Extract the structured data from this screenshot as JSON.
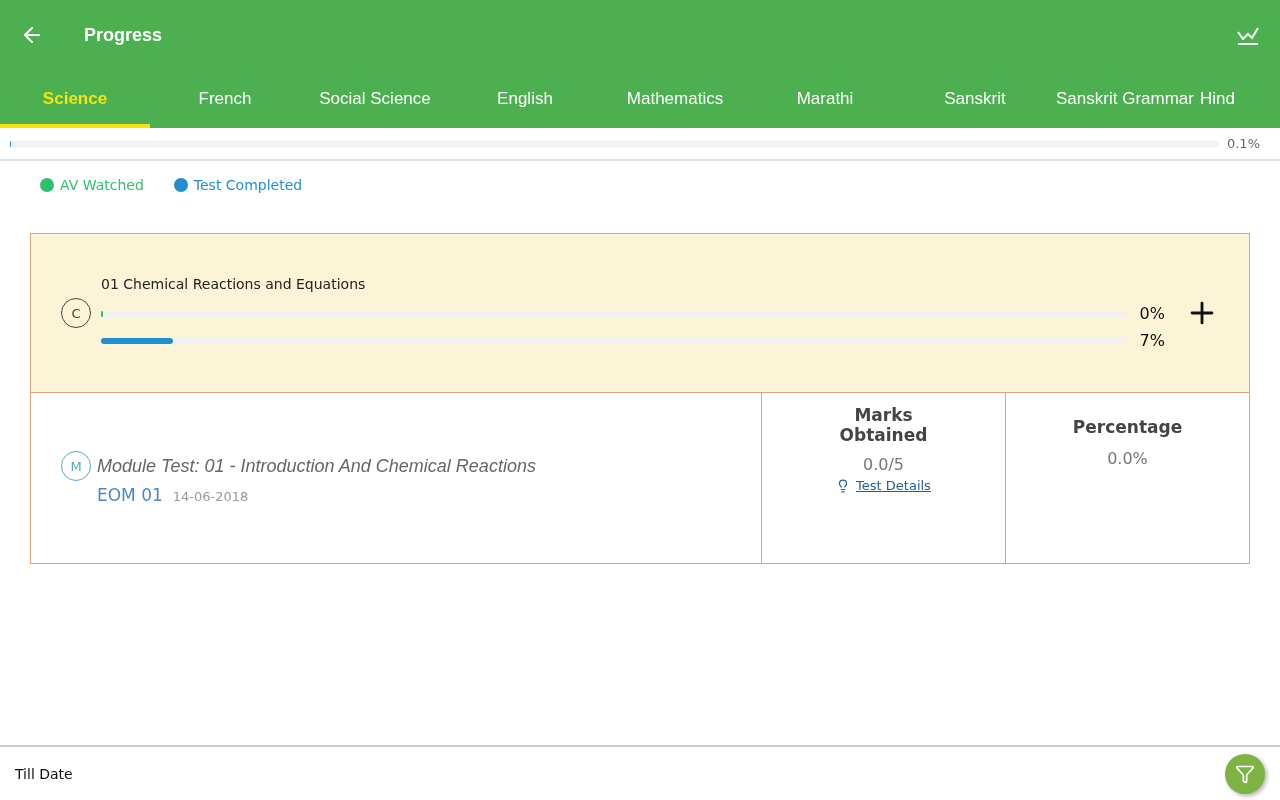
{
  "header": {
    "title": "Progress"
  },
  "tabs": [
    {
      "label": "Science",
      "selected": true
    },
    {
      "label": "French",
      "selected": false
    },
    {
      "label": "Social Science",
      "selected": false
    },
    {
      "label": "English",
      "selected": false
    },
    {
      "label": "Mathematics",
      "selected": false
    },
    {
      "label": "Marathi",
      "selected": false
    },
    {
      "label": "Sanskrit",
      "selected": false
    },
    {
      "label": "Sanskrit Grammar",
      "selected": false
    },
    {
      "label": "Hind",
      "selected": false
    }
  ],
  "overall": {
    "level": 0.001,
    "reading": "0.1%"
  },
  "legend": [
    {
      "label": "AV Watched",
      "color": "#2fbf71"
    },
    {
      "label": "Test Completed",
      "color": "#1e8fcf"
    }
  ],
  "chapter": {
    "badge": "C",
    "title": "01 Chemical Reactions and Equations",
    "bars": [
      {
        "level": 0,
        "reading": "0%"
      },
      {
        "level": 0.07,
        "reading": "7%"
      }
    ]
  },
  "tests": {
    "columns": [
      "Marks Obtained",
      "Percentage"
    ],
    "rows": [
      {
        "badge": "M",
        "title": "Module Test: 01 - Introduction And Chemical Reactions",
        "code": "EOM 01",
        "date": "14-06-2018",
        "marks": "0.0/5",
        "details": "Test Details",
        "percentage": "0.0%"
      }
    ]
  },
  "footer": {
    "label": "Till Date"
  }
}
